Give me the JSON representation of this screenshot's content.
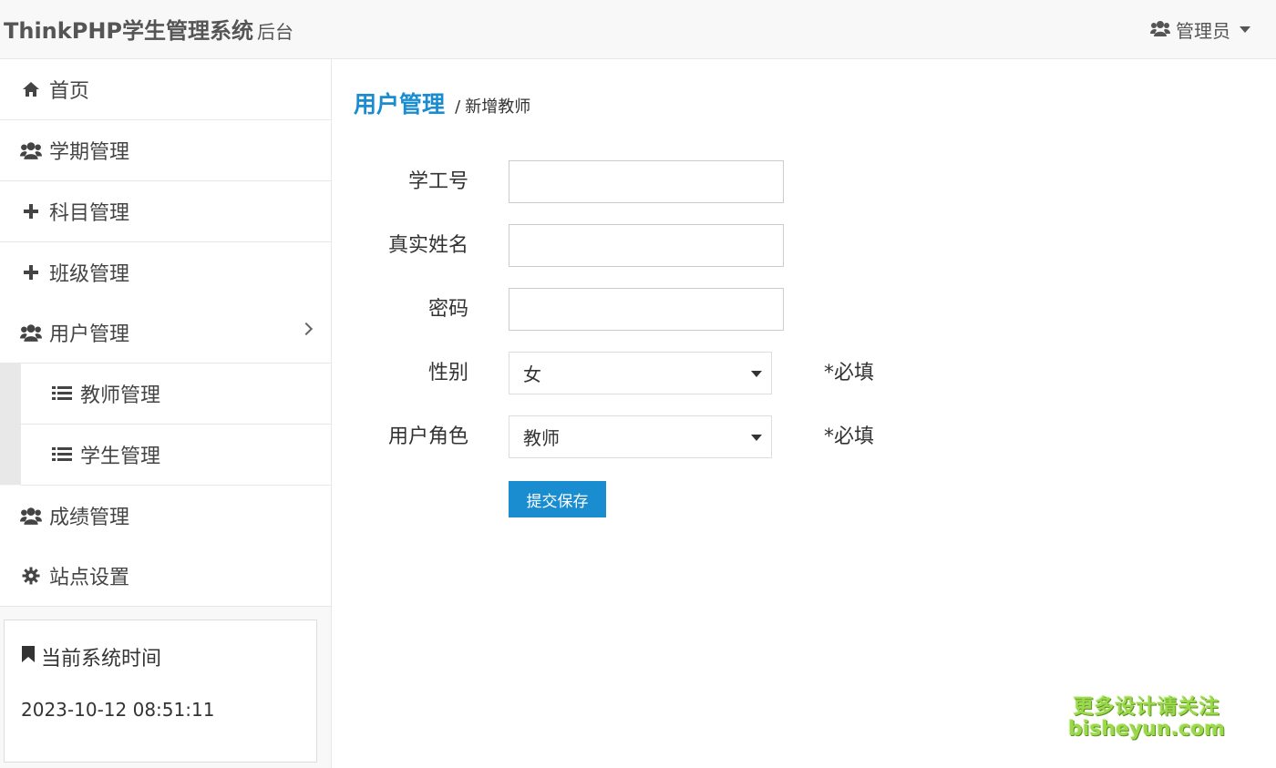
{
  "header": {
    "brand": "ThinkPHP学生管理系统",
    "brand_sub": "后台",
    "user_label": "管理员"
  },
  "sidebar": {
    "items": [
      {
        "label": "首页",
        "icon": "home-icon"
      },
      {
        "label": "学期管理",
        "icon": "users-icon"
      },
      {
        "label": "科目管理",
        "icon": "plus-icon"
      },
      {
        "label": "班级管理",
        "icon": "plus-icon"
      },
      {
        "label": "用户管理",
        "icon": "users-icon"
      },
      {
        "label": "教师管理",
        "icon": "list-icon"
      },
      {
        "label": "学生管理",
        "icon": "list-icon"
      },
      {
        "label": "成绩管理",
        "icon": "users-icon"
      },
      {
        "label": "站点设置",
        "icon": "gear-icon"
      }
    ],
    "time_panel": {
      "title": "当前系统时间",
      "value": "2023-10-12 08:51:11"
    }
  },
  "main": {
    "title": "用户管理",
    "subtitle": "新增教师",
    "form": {
      "id_label": "学工号",
      "id_value": "",
      "name_label": "真实姓名",
      "name_value": "",
      "password_label": "密码",
      "password_value": "",
      "gender_label": "性别",
      "gender_value": "女",
      "role_label": "用户角色",
      "role_value": "教师",
      "required_note": "*必填",
      "submit_label": "提交保存"
    }
  },
  "watermark": {
    "line1": "更多设计请关注",
    "line2": "bisheyun.com"
  },
  "colors": {
    "accent": "#1a8cd0",
    "watermark": "#9ad94a"
  }
}
